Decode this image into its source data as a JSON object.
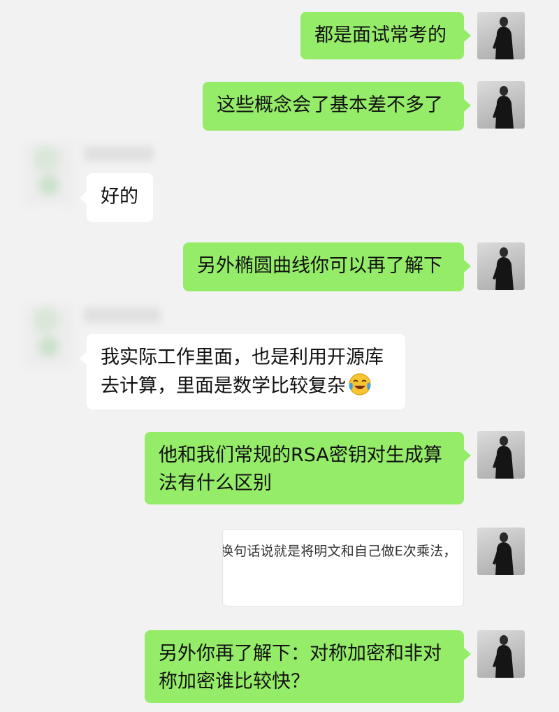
{
  "chat": {
    "messages": [
      {
        "id": 1,
        "sender": "self",
        "text": "都是面试常考的"
      },
      {
        "id": 2,
        "sender": "self",
        "text": "这些概念会了基本差不多了"
      },
      {
        "id": 3,
        "sender": "other",
        "text": "好的"
      },
      {
        "id": 4,
        "sender": "self",
        "text": "另外椭圆曲线你可以再了解下"
      },
      {
        "id": 5,
        "sender": "other",
        "lines": [
          "我实际工作里面，也是利用开源库",
          "去计算，里面是数学比较复杂"
        ],
        "emoji": "laughing-crying-emoji"
      },
      {
        "id": 6,
        "sender": "self",
        "lines": [
          "他和我们常规的RSA密钥对生成算",
          "法有什么区别"
        ]
      },
      {
        "id": 7,
        "sender": "self",
        "type": "image-card",
        "text": "换句话说就是将明文和自己做E次乘法，"
      },
      {
        "id": 8,
        "sender": "self",
        "lines": [
          "另外你再了解下：对称加密和非对",
          "称加密谁比较快？"
        ]
      }
    ]
  },
  "colors": {
    "background": "#f2f2f2",
    "self_bubble": "#95ec69",
    "other_bubble": "#ffffff"
  }
}
